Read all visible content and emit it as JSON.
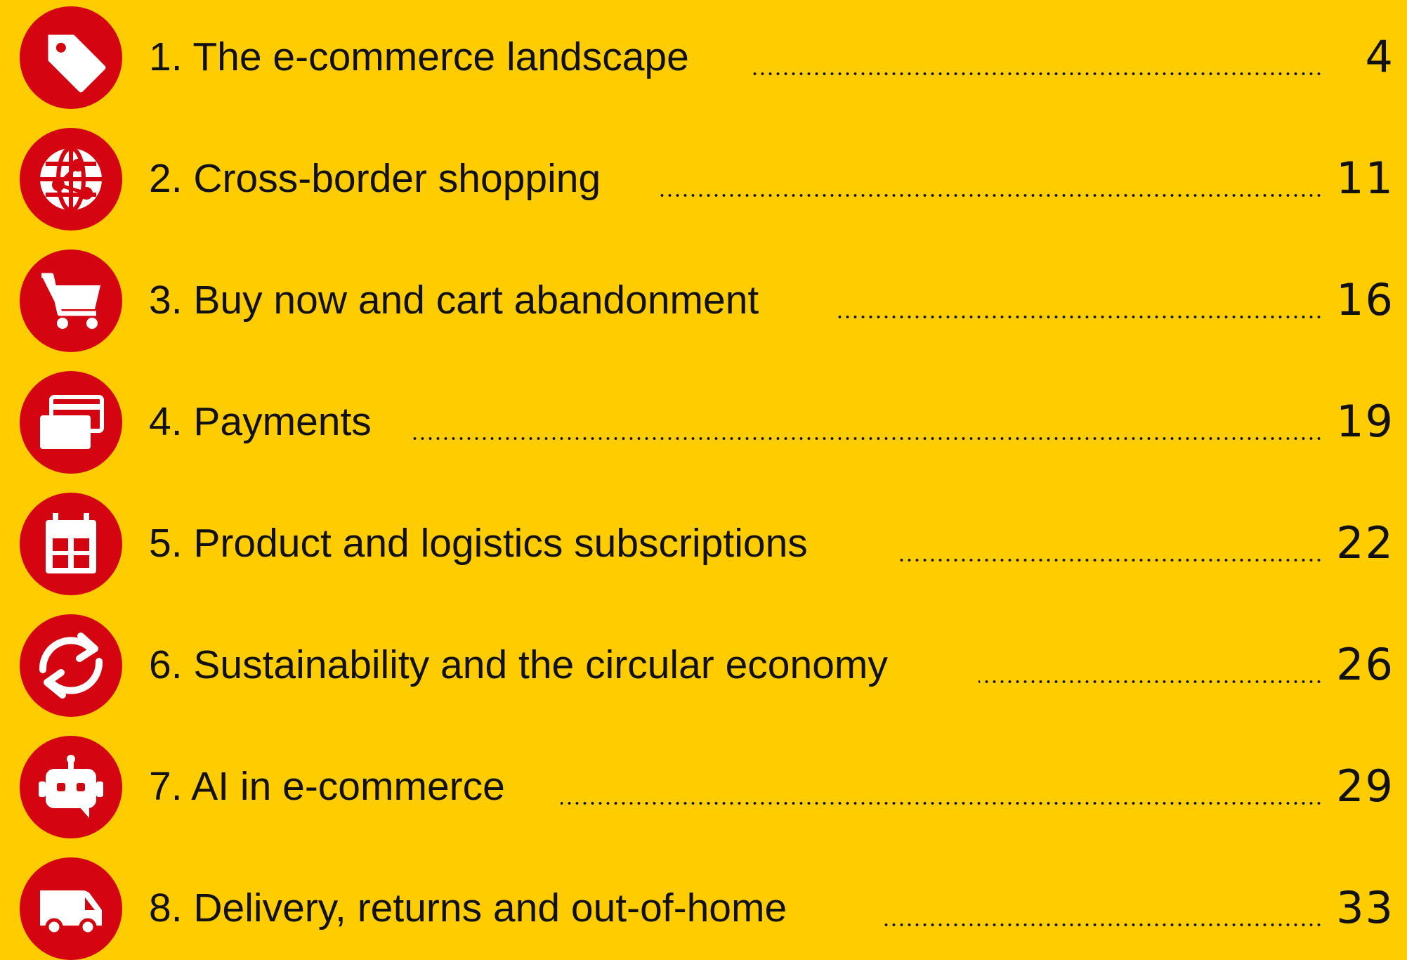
{
  "toc": [
    {
      "number": "1.",
      "title": "1. The e-commerce landscape",
      "page": "4",
      "icon": "price-tag-icon"
    },
    {
      "number": "2.",
      "title": "2. Cross-border shopping",
      "page": "11",
      "icon": "globe-network-icon"
    },
    {
      "number": "3.",
      "title": "3. Buy now and cart abandonment",
      "page": "16",
      "icon": "shopping-cart-icon"
    },
    {
      "number": "4.",
      "title": "4. Payments",
      "page": "19",
      "icon": "payment-cards-icon"
    },
    {
      "number": "5.",
      "title": "5. Product and logistics subscriptions",
      "page": "22",
      "icon": "calendar-icon"
    },
    {
      "number": "6.",
      "title": "6. Sustainability and the circular economy",
      "page": "26",
      "icon": "circular-arrows-icon"
    },
    {
      "number": "7.",
      "title": "7. AI in e-commerce",
      "page": "29",
      "icon": "robot-chat-icon"
    },
    {
      "number": "8.",
      "title": "8. Delivery, returns and out-of-home",
      "page": "33",
      "icon": "delivery-van-icon"
    }
  ],
  "colors": {
    "background": "#FFCC00",
    "accent": "#D40511",
    "text": "#111111",
    "icon": "#FFFFFF"
  }
}
